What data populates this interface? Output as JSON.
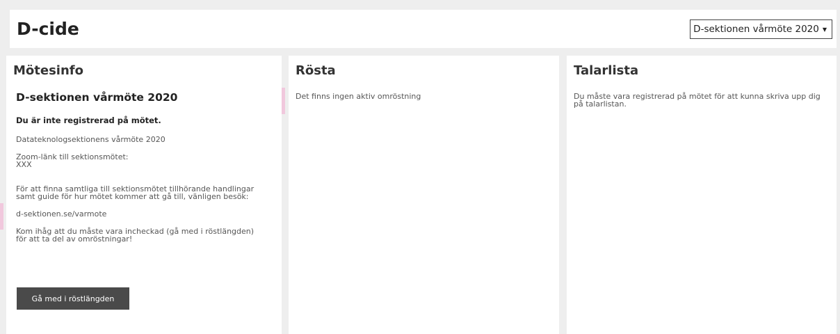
{
  "header": {
    "title": "D-cide",
    "meeting_select": "D-sektionen vårmöte 2020"
  },
  "info_panel": {
    "title": "Mötesinfo",
    "meeting_name": "D-sektionen vårmöte 2020",
    "registration_status": "Du är inte registrerad på mötet.",
    "description": "Datateknologsektionens vårmöte 2020",
    "zoom_label": "Zoom-länk till sektionsmötet:",
    "zoom_link": "XXX",
    "documents_line1": "För att finna samtliga till sektionsmötet tillhörande handlingar",
    "documents_line2": "samt guide för hur mötet kommer att gå till, vänligen besök:",
    "website": "d-sektionen.se/varmote",
    "reminder_line1": "Kom ihåg att du måste vara incheckad (gå med i röstlängden)",
    "reminder_line2": "för att ta del av omröstningar!",
    "join_button": "Gå med i röstlängden"
  },
  "vote_panel": {
    "title": "Rösta",
    "status": "Det finns ingen aktiv omröstning"
  },
  "speakers_panel": {
    "title": "Talarlista",
    "notice_line1": "Du måste vara registrerad på mötet för att kunna skriva upp dig",
    "notice_line2": "på talarlistan."
  },
  "icons": {
    "select_caret": "caret-down-icon"
  },
  "colors": {
    "background": "#eeeeee",
    "panel": "#ffffff",
    "button": "#4a4a4a",
    "accent": "#f1c8dd"
  }
}
